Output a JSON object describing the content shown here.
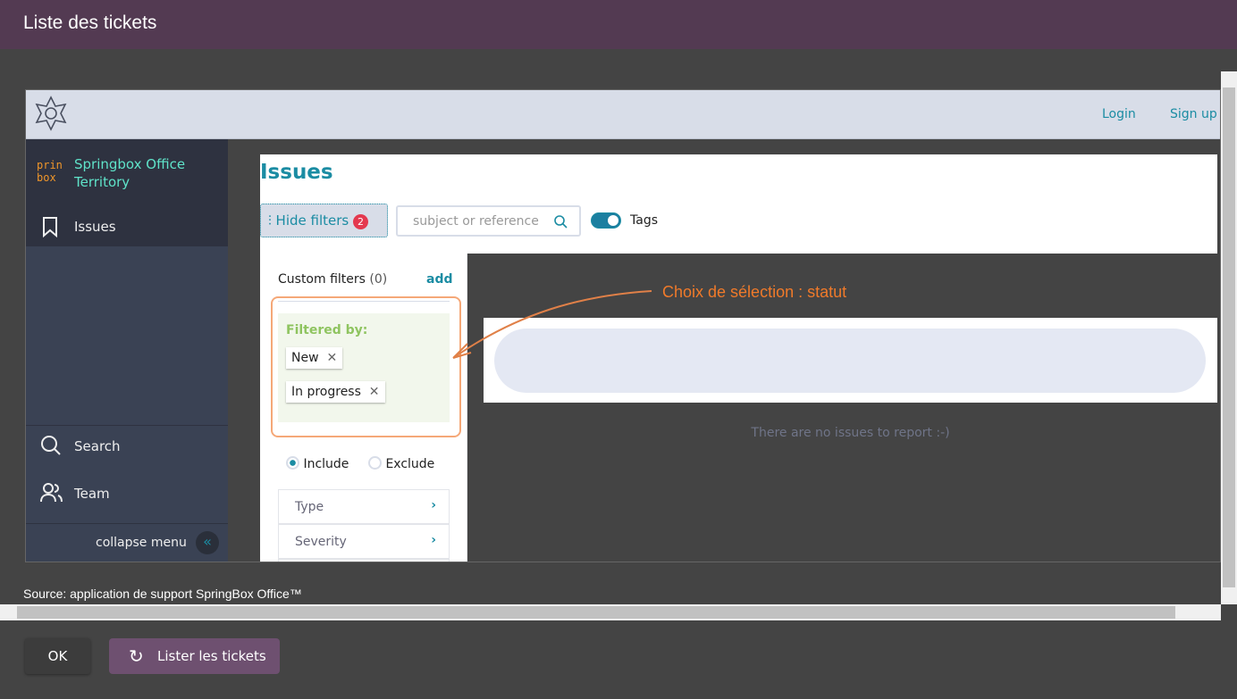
{
  "window": {
    "title": "Liste des tickets"
  },
  "header": {
    "login": "Login",
    "signup": "Sign up"
  },
  "sidebar": {
    "org_name": "Springbox Office Territory",
    "logo_text": "prin box",
    "items": [
      {
        "label": "Issues"
      },
      {
        "label": "Search"
      },
      {
        "label": "Team"
      }
    ],
    "collapse": "collapse menu"
  },
  "main": {
    "title": "Issues",
    "hide_filters": "Hide filters",
    "filter_count": "2",
    "search_placeholder": "subject or reference",
    "tags_label": "Tags",
    "tags_on": true,
    "empty_text": "There are no issues to report :-)"
  },
  "filters": {
    "custom_label": "Custom filters",
    "custom_count": "(0)",
    "add": "add",
    "filtered_by": "Filtered by:",
    "chips": [
      "New",
      "In progress"
    ],
    "include": "Include",
    "exclude": "Exclude",
    "mode": "Include",
    "categories": [
      "Type",
      "Severity"
    ]
  },
  "annotation": {
    "text": "Choix de sélection : statut",
    "color": "#f07a2a"
  },
  "source": "Source: application de support SpringBox Office™",
  "footer": {
    "ok": "OK",
    "list": "Lister les tickets"
  },
  "colors": {
    "accent": "#1b8ca3",
    "titlebar": "#533a52",
    "badge": "#e4394f"
  }
}
